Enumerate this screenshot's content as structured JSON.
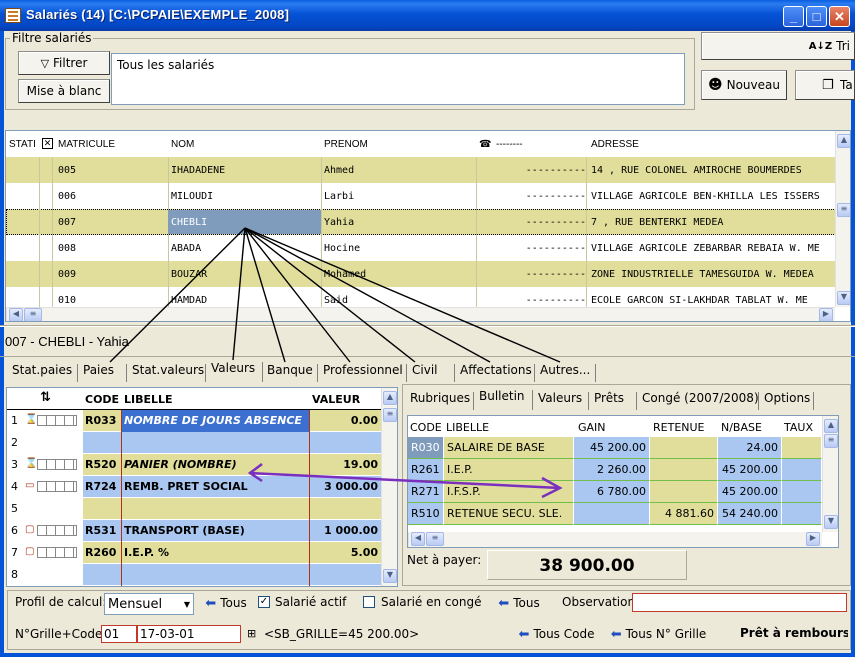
{
  "window": {
    "title": "Salariés (14) [C:\\PCPAIE\\EXEMPLE_2008]",
    "min": "_",
    "max": "□",
    "close": "✕"
  },
  "filter": {
    "legend": "Filtre salariés",
    "filter_button": "Filtrer",
    "reset_button": "Mise à blanc",
    "value": "Tous les salariés"
  },
  "side": {
    "sort_button": "Tri",
    "new_button": "Nouveau",
    "table_button": "Ta"
  },
  "employees": {
    "columns": [
      "STATI",
      "MATRICULE",
      "NOM",
      "PRENOM",
      "--------",
      "ADRESSE"
    ],
    "rows": [
      {
        "matricule": "005",
        "nom": "IHADADENE",
        "prenom": "Ahmed",
        "tel": "----------",
        "adresse": "14 , RUE COLONEL AMIROCHE BOUMERDES"
      },
      {
        "matricule": "006",
        "nom": "MILOUDI",
        "prenom": "Larbi",
        "tel": "----------",
        "adresse": "VILLAGE AGRICOLE BEN-KHILLA LES ISSERS"
      },
      {
        "matricule": "007",
        "nom": "CHEBLI",
        "prenom": "Yahia",
        "tel": "----------",
        "adresse": "7 , RUE BENTERKI MEDEA"
      },
      {
        "matricule": "008",
        "nom": "ABADA",
        "prenom": "Hocine",
        "tel": "----------",
        "adresse": "VILLAGE AGRICOLE ZEBARBAR REBAIA W. ME"
      },
      {
        "matricule": "009",
        "nom": "BOUZAR",
        "prenom": "Mohamed",
        "tel": "----------",
        "adresse": "ZONE INDUSTRIELLE TAMESGUIDA W. MEDEA"
      },
      {
        "matricule": "010",
        "nom": "HAMDAD",
        "prenom": "Said",
        "tel": "----------",
        "adresse": "ECOLE GARCON SI-LAKHDAR TABLAT W. ME"
      }
    ]
  },
  "selected_label": "007 - CHEBLI - Yahia",
  "tabs": [
    "Stat.paies",
    "Paies",
    "Stat.valeurs",
    "Valeurs",
    "Banque",
    "Professionnel",
    "Civil",
    "Affectations",
    "Autres..."
  ],
  "values_grid": {
    "columns": [
      "CODE",
      "LIBELLE",
      "VALEUR"
    ],
    "rows": [
      {
        "num": "1",
        "code": "R033",
        "libelle": "NOMBRE DE JOURS ABSENCE",
        "valeur": "0.00"
      },
      {
        "num": "2",
        "code": "",
        "libelle": "",
        "valeur": ""
      },
      {
        "num": "3",
        "code": "R520",
        "libelle": "PANIER (NOMBRE)",
        "valeur": "19.00"
      },
      {
        "num": "4",
        "code": "R724",
        "libelle": "REMB. PRET SOCIAL",
        "valeur": "3 000.00"
      },
      {
        "num": "5",
        "code": "",
        "libelle": "",
        "valeur": ""
      },
      {
        "num": "6",
        "code": "R531",
        "libelle": "TRANSPORT (BASE)",
        "valeur": "1 000.00"
      },
      {
        "num": "7",
        "code": "R260",
        "libelle": "I.E.P. %",
        "valeur": "5.00"
      },
      {
        "num": "8",
        "code": "",
        "libelle": "",
        "valeur": ""
      }
    ]
  },
  "right_tabs": [
    "Rubriques",
    "Bulletin",
    "Valeurs",
    "Prêts",
    "Congé (2007/2008)",
    "Options"
  ],
  "bulletin": {
    "columns": [
      "CODE",
      "LIBELLE",
      "GAIN",
      "RETENUE",
      "N/BASE",
      "TAUX"
    ],
    "rows": [
      {
        "code": "R030",
        "libelle": "SALAIRE DE BASE",
        "gain": "45 200.00",
        "retenue": "",
        "base": "24.00"
      },
      {
        "code": "R261",
        "libelle": "I.E.P.",
        "gain": "2 260.00",
        "retenue": "",
        "base": "45 200.00"
      },
      {
        "code": "R271",
        "libelle": "I.F.S.P.",
        "gain": "6 780.00",
        "retenue": "",
        "base": "45 200.00"
      },
      {
        "code": "R510",
        "libelle": "RETENUE SECU. SLE.",
        "gain": "",
        "retenue": "4 881.60",
        "base": "54 240.00"
      }
    ],
    "net_label": "Net à payer:",
    "net_value": "38 900.00"
  },
  "footer": {
    "profil_label": "Profil de calcul:",
    "profil_value": "Mensuel",
    "tous1": "Tous",
    "salarie_actif": "Salarié actif",
    "salarie_conge": "Salarié en congé",
    "tous2": "Tous",
    "observation": "Observation:",
    "grille_label": "N°Grille+Code:",
    "grille_num": "01",
    "grille_code": "17-03-01",
    "sb_grille": "<SB_GRILLE=45 200.00>",
    "tous_code": "Tous Code",
    "tous_grille": "Tous N° Grille",
    "pret": "Prêt à rembourser:-"
  }
}
